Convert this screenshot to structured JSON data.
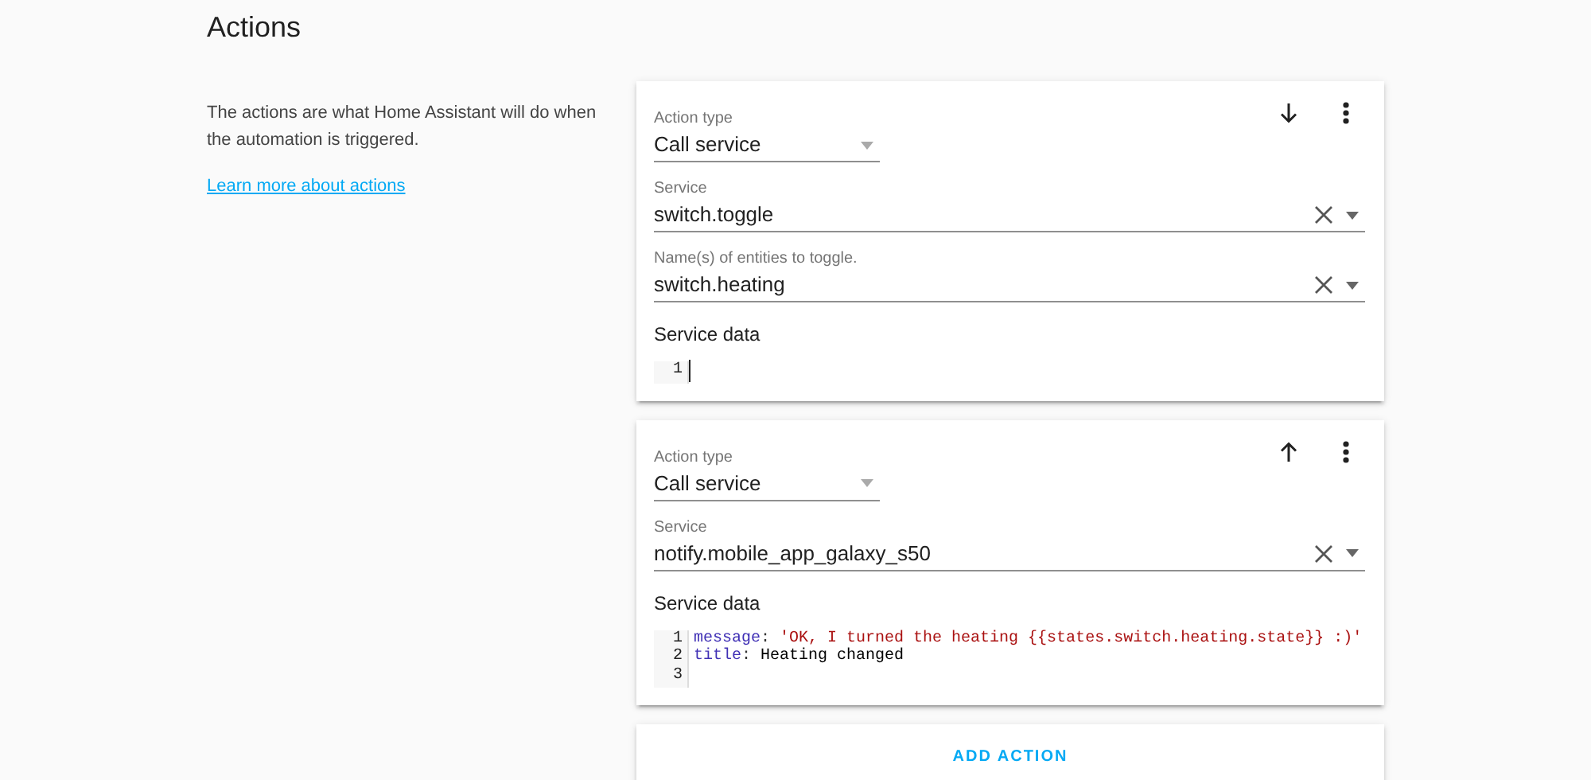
{
  "section": {
    "title": "Actions",
    "description": "The actions are what Home Assistant will do when the automation is triggered.",
    "link": "Learn more about actions"
  },
  "actions": [
    {
      "kind": "first",
      "fields": [
        {
          "kind": "select",
          "label": "Action type",
          "value": "Call service"
        },
        {
          "kind": "combo",
          "label": "Service",
          "value": "switch.toggle"
        },
        {
          "kind": "combo",
          "label": "Name(s) of entities to toggle.",
          "value": "switch.heating"
        }
      ],
      "data_label": "Service data",
      "code": [
        {
          "number": "1",
          "cursor": true
        }
      ]
    },
    {
      "kind": "last",
      "fields": [
        {
          "kind": "select",
          "label": "Action type",
          "value": "Call service"
        },
        {
          "kind": "combo",
          "label": "Service",
          "value": "notify.mobile_app_galaxy_s50"
        }
      ],
      "data_label": "Service data",
      "code": [
        {
          "number": "1",
          "cursor": false,
          "segments": [
            {
              "kind": "key",
              "text": "message"
            },
            {
              "kind": "punct",
              "text": ": "
            },
            {
              "kind": "string",
              "text": "'OK, I turned the heating {{states.switch.heating.state}} :)'"
            }
          ]
        },
        {
          "number": "2",
          "cursor": false,
          "segments": [
            {
              "kind": "key",
              "text": "title"
            },
            {
              "kind": "punct",
              "text": ": "
            },
            {
              "kind": "plain",
              "text": "Heating changed"
            }
          ]
        },
        {
          "number": "3",
          "cursor": false
        }
      ]
    }
  ],
  "add_button": "ADD ACTION"
}
